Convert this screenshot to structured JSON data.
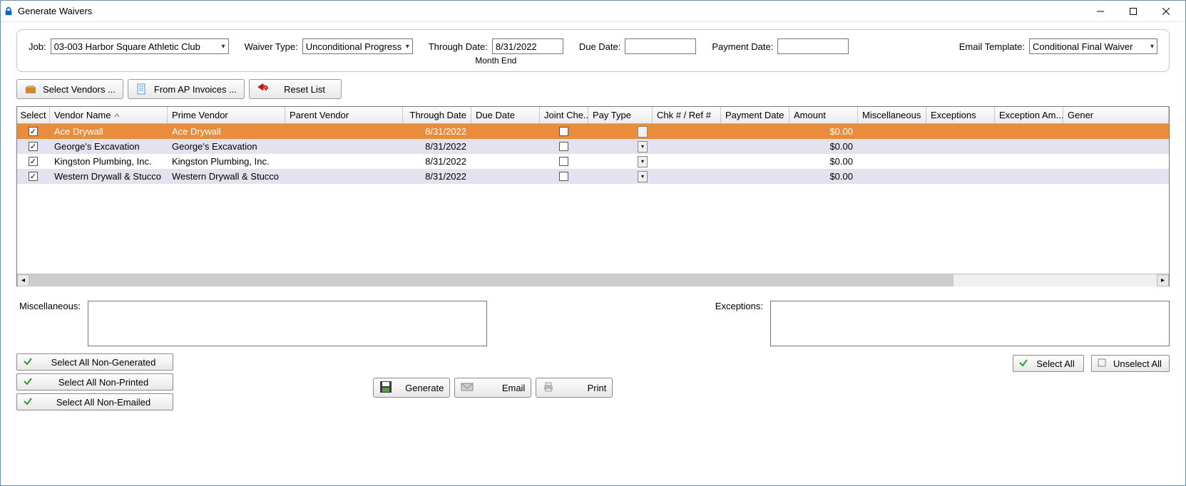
{
  "window": {
    "title": "Generate Waivers"
  },
  "filters": {
    "job_label": "Job:",
    "job_value": "03-003  Harbor Square Athletic Club",
    "waiver_type_label": "Waiver Type:",
    "waiver_type_value": "Unconditional Progress",
    "through_label": "Through Date:",
    "through_value": "8/31/2022",
    "month_end": "Month End",
    "due_label": "Due Date:",
    "due_value": "",
    "payment_label": "Payment Date:",
    "payment_value": "",
    "template_label": "Email Template:",
    "template_value": "Conditional Final Waiver"
  },
  "toolbar": {
    "select_vendors": "Select Vendors ...",
    "from_ap": "From AP Invoices ...",
    "reset": "Reset List"
  },
  "grid": {
    "cols": {
      "select": "Select",
      "vendor": "Vendor Name",
      "prime": "Prime Vendor",
      "parent": "Parent Vendor",
      "through": "Through Date",
      "due": "Due Date",
      "joint": "Joint Che...",
      "paytype": "Pay Type",
      "chkref": "Chk # / Ref #",
      "paydate": "Payment Date",
      "amount": "Amount",
      "misc": "Miscellaneous",
      "exc": "Exceptions",
      "excamt": "Exception Am...",
      "gener": "Gener"
    },
    "rows": [
      {
        "checked": true,
        "vendor": "Ace Drywall",
        "prime": "Ace Drywall",
        "through": "8/31/2022",
        "joint": false,
        "amount": "$0.00",
        "sel": true
      },
      {
        "checked": true,
        "vendor": "George's Excavation",
        "prime": "George's Excavation",
        "through": "8/31/2022",
        "joint": false,
        "amount": "$0.00",
        "alt": true
      },
      {
        "checked": true,
        "vendor": "Kingston Plumbing, Inc.",
        "prime": "Kingston Plumbing, Inc.",
        "through": "8/31/2022",
        "joint": false,
        "amount": "$0.00"
      },
      {
        "checked": true,
        "vendor": "Western Drywall & Stucco",
        "prime": "Western Drywall & Stucco",
        "through": "8/31/2022",
        "joint": false,
        "amount": "$0.00",
        "alt": true
      }
    ]
  },
  "lower": {
    "misc_label": "Miscellaneous:",
    "exc_label": "Exceptions:"
  },
  "bottom": {
    "non_generated": "Select All Non-Generated",
    "non_printed": "Select All Non-Printed",
    "non_emailed": "Select All Non-Emailed",
    "generate": "Generate",
    "email": "Email",
    "print": "Print",
    "select_all": "Select All",
    "unselect_all": "Unselect All"
  }
}
